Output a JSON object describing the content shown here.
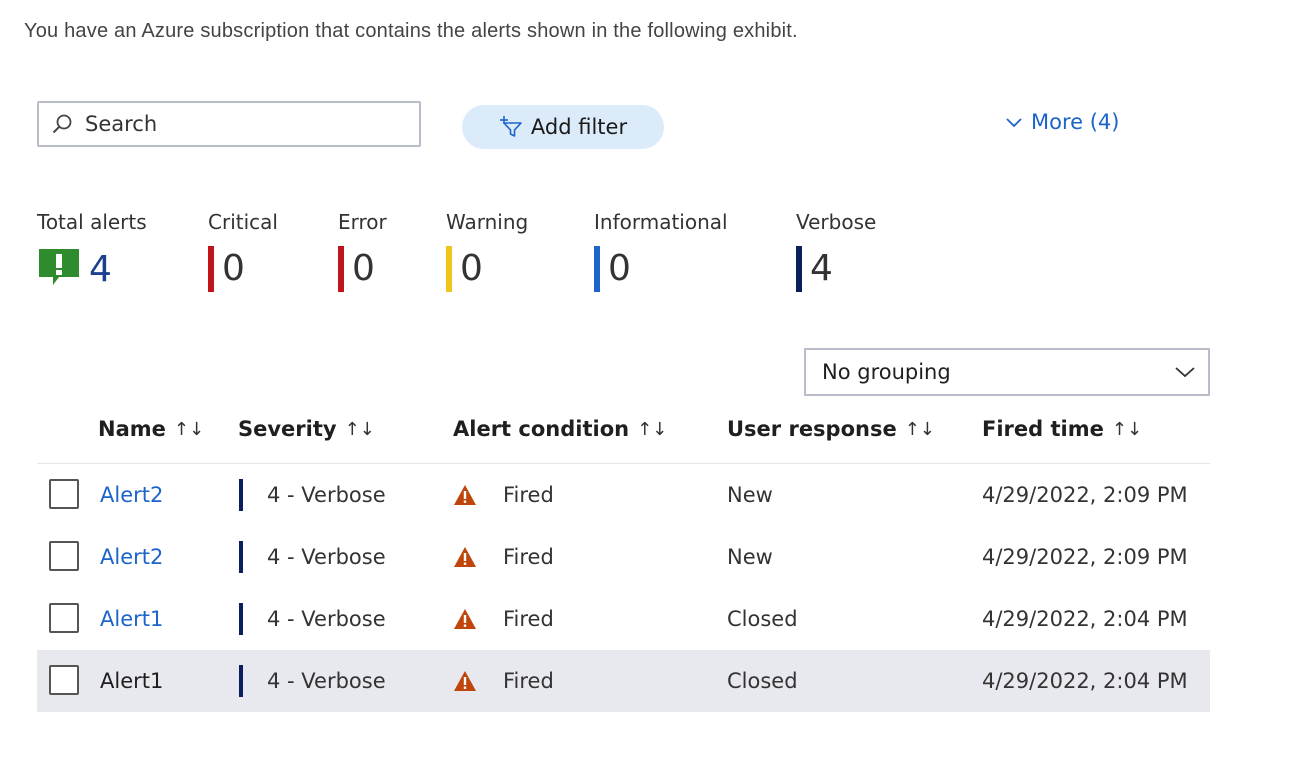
{
  "intro_text": "You have an Azure subscription that contains the alerts shown in the following exhibit.",
  "toolbar": {
    "search_placeholder": "Search",
    "add_filter_label": "Add filter",
    "more_label": "More (4)"
  },
  "summary": {
    "total": {
      "label": "Total alerts",
      "value": "4",
      "icon": "alert-icon",
      "color": "#2e8b2e"
    },
    "critical": {
      "label": "Critical",
      "value": "0",
      "color": "#c0141a"
    },
    "error": {
      "label": "Error",
      "value": "0",
      "color": "#c0141a"
    },
    "warning": {
      "label": "Warning",
      "value": "0",
      "color": "#f0c41a"
    },
    "informational": {
      "label": "Informational",
      "value": "0",
      "color": "#1c64c9"
    },
    "verbose": {
      "label": "Verbose",
      "value": "4",
      "color": "#0b1f5e"
    }
  },
  "grouping": {
    "selected": "No grouping"
  },
  "table": {
    "columns": [
      "Name",
      "Severity",
      "Alert condition",
      "User response",
      "Fired time"
    ],
    "rows": [
      {
        "name": "Alert2",
        "severity": "4 - Verbose",
        "condition": "Fired",
        "response": "New",
        "fired_time": "4/29/2022, 2:09 PM"
      },
      {
        "name": "Alert2",
        "severity": "4 - Verbose",
        "condition": "Fired",
        "response": "New",
        "fired_time": "4/29/2022, 2:09 PM"
      },
      {
        "name": "Alert1",
        "severity": "4 - Verbose",
        "condition": "Fired",
        "response": "Closed",
        "fired_time": "4/29/2022, 2:04 PM"
      },
      {
        "name": "Alert1",
        "severity": "4 - Verbose",
        "condition": "Fired",
        "response": "Closed",
        "fired_time": "4/29/2022, 2:04 PM"
      }
    ]
  },
  "colors": {
    "link": "#1c64c9",
    "warning_icon": "#c0450a",
    "selected_row": "#e8e8ef"
  }
}
